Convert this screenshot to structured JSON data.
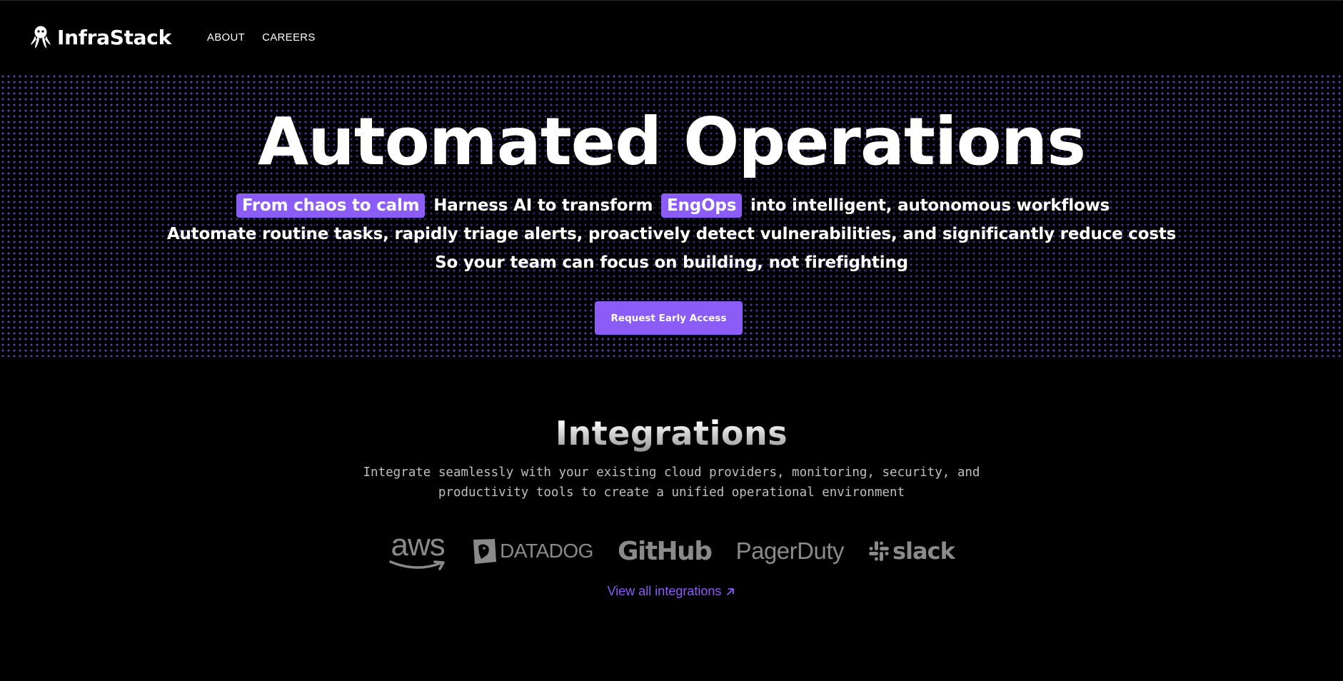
{
  "header": {
    "brand": "InfraStack",
    "nav": [
      {
        "label": "ABOUT"
      },
      {
        "label": "CAREERS"
      }
    ]
  },
  "hero": {
    "title": "Automated Operations",
    "line1": {
      "pill1": "From chaos to calm",
      "text1": "Harness AI to transform",
      "pill2": "EngOps",
      "text2": "into intelligent, autonomous workflows"
    },
    "line2": "Automate routine tasks, rapidly triage alerts, proactively detect vulnerabilities, and significantly reduce costs",
    "line3": "So your team can focus on building, not firefighting",
    "cta_label": "Request Early Access"
  },
  "integrations": {
    "title": "Integrations",
    "description_line1": "Integrate seamlessly with your existing cloud providers, monitoring, security, and",
    "description_line2": "productivity tools to create a unified operational environment",
    "logos": [
      {
        "name": "aws",
        "icon": "aws-logo"
      },
      {
        "name": "DATADOG",
        "icon": "datadog-logo"
      },
      {
        "name": "GitHub",
        "icon": "github-logo"
      },
      {
        "name": "PagerDuty",
        "icon": "pagerduty-logo"
      },
      {
        "name": "slack",
        "icon": "slack-logo"
      }
    ],
    "view_all_label": "View all integrations"
  },
  "colors": {
    "accent": "#8b5cf6",
    "background": "#000000",
    "logo_gray": "#8a8a8a",
    "dot_grid": "#6e5ff0"
  }
}
